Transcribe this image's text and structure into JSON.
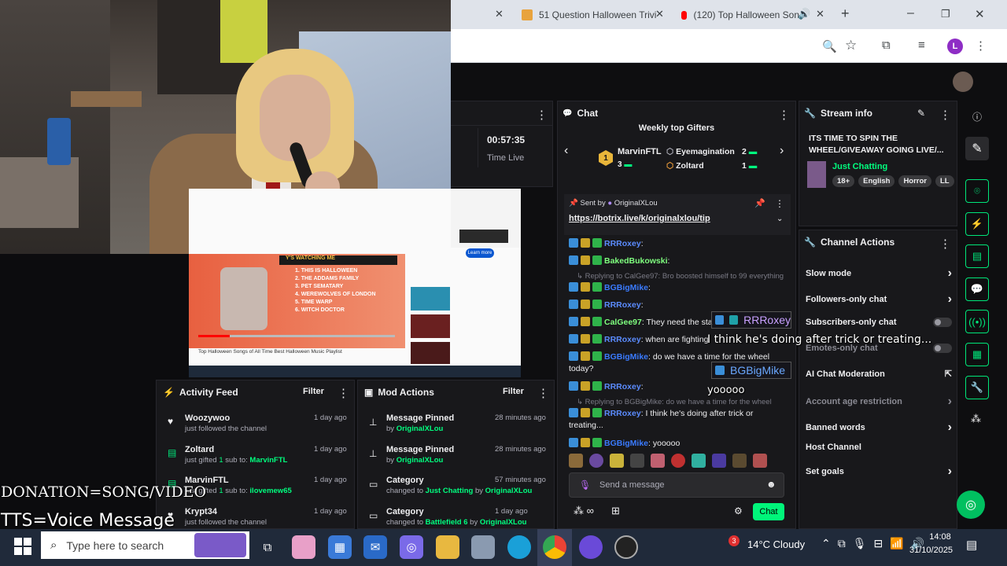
{
  "browser": {
    "tabs": [
      {
        "title": "51 Question Halloween Trivi"
      },
      {
        "title": "(120) Top Halloween Son"
      }
    ],
    "profile_initial": "L"
  },
  "left_panel": {
    "time": "00:57:35",
    "time_label": "Time Live"
  },
  "chat": {
    "title": "Chat",
    "gifters_title": "Weekly top Gifters",
    "gifters": [
      {
        "rank": "1",
        "name": "MarvinFTL",
        "count": "3"
      },
      {
        "rank": "",
        "name": "Eyemagination",
        "count": "2"
      },
      {
        "rank": "",
        "name": "Zoltard",
        "count": "1"
      }
    ],
    "pinned": {
      "sent_by_label": "Sent by",
      "sender": "OriginalXLou",
      "link": "https://botrix.live/k/originalxlou/tip"
    },
    "messages": [
      {
        "name": "RRRoxey",
        "color": "#5b8cff",
        "text": ":"
      },
      {
        "name": "BakedBukowski",
        "color": "#7fff7f",
        "text": ":"
      },
      {
        "reply": "Replying to CalGee97: Bro boosted himself to 99 everything"
      },
      {
        "name": "BGBigMike",
        "color": "#3a7bff",
        "text": ":"
      },
      {
        "name": "RRRoxey",
        "color": "#5b8cff",
        "text": ":"
      },
      {
        "name": "CalGee97",
        "color": "#7fff7f",
        "text": ": They need the sta"
      },
      {
        "name": "RRRoxey",
        "color": "#5b8cff",
        "text": ": when are fighting"
      },
      {
        "name": "BGBigMike",
        "color": "#3a7bff",
        "text": ": do we have a time for the wheel"
      },
      {
        "cont": "today?"
      },
      {
        "name": "RRRoxey",
        "color": "#5b8cff",
        "text": ":"
      },
      {
        "reply": "Replying to BGBigMike: do we have a time for the wheel"
      },
      {
        "name": "RRRoxey",
        "color": "#5b8cff",
        "text": ": I think he's doing after trick or"
      },
      {
        "cont": "treating..."
      },
      {
        "name": "BGBigMike",
        "color": "#3a7bff",
        "text": ": yooooo"
      }
    ],
    "input_placeholder": "Send a message",
    "chat_button": "Chat"
  },
  "stream_info": {
    "title": "Stream info",
    "stream_title": "ITS TIME TO SPIN THE WHEEL/GIVEAWAY GOING LIVE/...",
    "category": "Just Chatting",
    "tags": [
      "18+",
      "English",
      "Horror",
      "LL"
    ]
  },
  "channel_actions": {
    "title": "Channel Actions",
    "items": [
      {
        "label": "Slow mode",
        "control": "chevron"
      },
      {
        "label": "Followers-only chat",
        "control": "chevron"
      },
      {
        "label": "Subscribers-only chat",
        "control": "toggle"
      },
      {
        "label": "Emotes-only chat",
        "control": "toggle"
      },
      {
        "label": "AI Chat Moderation",
        "control": "external"
      },
      {
        "label": "Account age restriction",
        "control": "chevron"
      },
      {
        "label": "Banned words",
        "control": "chevron"
      },
      {
        "label": "Host Channel",
        "control": "none"
      },
      {
        "label": "Set goals",
        "control": "chevron"
      }
    ]
  },
  "activity_feed": {
    "title": "Activity Feed",
    "filter": "Filter",
    "items": [
      {
        "name": "Woozywoo",
        "sub": "just followed the channel",
        "ago": "1 day ago",
        "icon": "heart-icon"
      },
      {
        "name": "Zoltard",
        "sub_pre": "just gifted ",
        "sub_num": "1",
        "sub_mid": " sub to: ",
        "sub_target": "MarvinFTL",
        "ago": "1 day ago",
        "icon": "gift-icon"
      },
      {
        "name": "MarvinFTL",
        "sub_pre": "just gifted ",
        "sub_num": "1",
        "sub_mid": " sub to: ",
        "sub_target": "ilovemew65",
        "ago": "1 day ago",
        "icon": "gift-icon"
      },
      {
        "name": "Krypt34",
        "sub": "just followed the channel",
        "ago": "1 day ago",
        "icon": "heart-icon"
      }
    ]
  },
  "mod_actions": {
    "title": "Mod Actions",
    "filter": "Filter",
    "items": [
      {
        "title": "Message Pinned",
        "by": "by ",
        "who": "OriginalXLou",
        "ago": "28 minutes ago",
        "icon": "pin-icon"
      },
      {
        "title": "Message Pinned",
        "by": "by ",
        "who": "OriginalXLou",
        "ago": "28 minutes ago",
        "icon": "pin-icon"
      },
      {
        "title": "Category",
        "pre": "changed to ",
        "cat": "Just Chatting",
        "by": " by ",
        "who": "OriginalXLou",
        "ago": "57 minutes ago",
        "icon": "category-icon"
      },
      {
        "title": "Category",
        "pre": "changed to ",
        "cat": "Battlefield 6",
        "by": " by ",
        "who": "OriginalXLou",
        "ago": "1 day ago",
        "icon": "category-icon"
      }
    ]
  },
  "overlay": {
    "popup1_name": "RRRoxey",
    "popup1_text": "I think he's doing after trick or treating...",
    "popup2_name": "BGBigMike",
    "popup2_text": "yooooo",
    "donation": "DONATION=SONG/VIDEO",
    "tts": "TTS=Voice Message"
  },
  "video_embed": {
    "playlist": [
      "THIS IS HALLOWEEN",
      "THE ADDAMS FAMILY",
      "PET SEMATARY",
      "WEREWOLVES OF LONDON",
      "TIME WARP",
      "WITCH DOCTOR"
    ],
    "header": "Y'S WATCHING ME",
    "caption": "Top Halloween Songs of All Time Best Halloween Music Playlist",
    "learn_more": "Learn more"
  },
  "taskbar": {
    "search_placeholder": "Type here to search",
    "weather": "14°C  Cloudy",
    "time": "14:08",
    "date": "31/10/2025",
    "notification_count": "3"
  }
}
